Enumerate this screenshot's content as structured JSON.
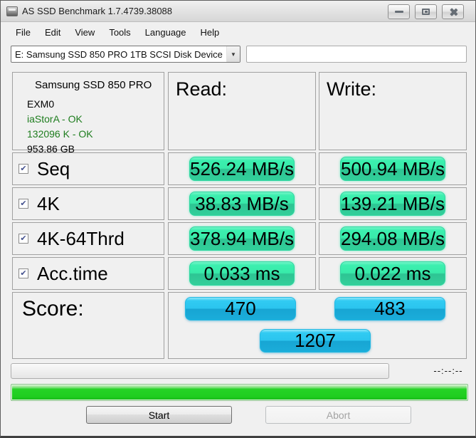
{
  "window": {
    "title": "AS SSD Benchmark 1.7.4739.38088"
  },
  "menu": {
    "file": "File",
    "edit": "Edit",
    "view": "View",
    "tools": "Tools",
    "language": "Language",
    "help": "Help"
  },
  "drive_select": {
    "value": "E: Samsung SSD 850 PRO 1TB SCSI Disk Device"
  },
  "info": {
    "model": "Samsung SSD 850 PRO",
    "firmware": "EXM0",
    "driver": "iaStorA - OK",
    "alignment": "132096 K - OK",
    "capacity": "953.86 GB"
  },
  "columns": {
    "read": "Read:",
    "write": "Write:"
  },
  "rows": [
    {
      "label": "Seq",
      "checked": true,
      "read": "526.24 MB/s",
      "write": "500.94 MB/s"
    },
    {
      "label": "4K",
      "checked": true,
      "read": "38.83 MB/s",
      "write": "139.21 MB/s"
    },
    {
      "label": "4K-64Thrd",
      "checked": true,
      "read": "378.94 MB/s",
      "write": "294.08 MB/s"
    },
    {
      "label": "Acc.time",
      "checked": true,
      "read": "0.033 ms",
      "write": "0.022 ms"
    }
  ],
  "score": {
    "label": "Score:",
    "read": "470",
    "write": "483",
    "total": "1207"
  },
  "progress": {
    "time_remaining": "--:--:--"
  },
  "buttons": {
    "start": "Start",
    "abort": "Abort"
  },
  "icons": {
    "check": "✔",
    "dropdown_arrow": "▼"
  },
  "colors": {
    "result_pill_green": "#38EAA9",
    "score_pill_blue": "#2BC4EE",
    "progress_green": "#1FCD1F",
    "ok_text_green": "#1E7D1E",
    "window_bg": "#F0F0F0"
  }
}
